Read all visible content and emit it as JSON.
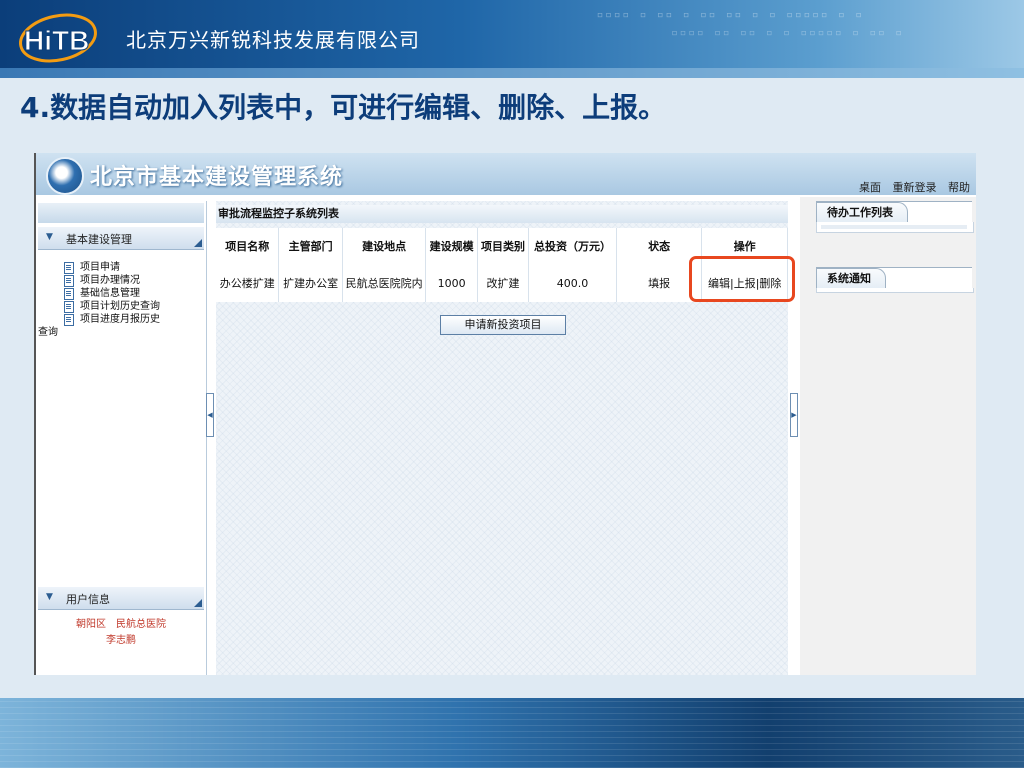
{
  "slide": {
    "company": "北京万兴新锐科技发展有限公司",
    "logo_text": "HiTB",
    "title": "4.数据自动加入列表中，可进行编辑、删除、上报。"
  },
  "app": {
    "title": "北京市基本建设管理系统",
    "top_links": [
      "桌面",
      "重新登录",
      "帮助"
    ],
    "sidebar": {
      "section1_label": "基本建设管理",
      "items": [
        "项目申请",
        "项目办理情况",
        "基础信息管理",
        "项目计划历史查询",
        "项目进度月报历史"
      ],
      "wrap_text": "查询",
      "section2_label": "用户信息",
      "user_line1": "朝阳区　民航总医院",
      "user_line2": "李志鹏"
    },
    "main": {
      "panel_title": "审批流程监控子系统列表",
      "columns": [
        "项目名称",
        "主管部门",
        "建设地点",
        "建设规模",
        "项目类别",
        "总投资（万元）",
        "状态",
        "操作"
      ],
      "row": {
        "name": "办公楼扩建",
        "dept": "扩建办公室",
        "location": "民航总医院院内",
        "scale": "1000",
        "category": "改扩建",
        "investment": "400.0",
        "status": "填报",
        "op_edit": "编辑",
        "op_report": "上报",
        "op_delete": "删除"
      },
      "apply_button": "申请新投资项目"
    },
    "right": {
      "todo_tab": "待办工作列表",
      "notice_tab": "系统通知"
    }
  },
  "colors": {
    "highlight": "#e8471f",
    "title_blue": "#0d3d7a",
    "user_info_red": "#c0392b"
  }
}
